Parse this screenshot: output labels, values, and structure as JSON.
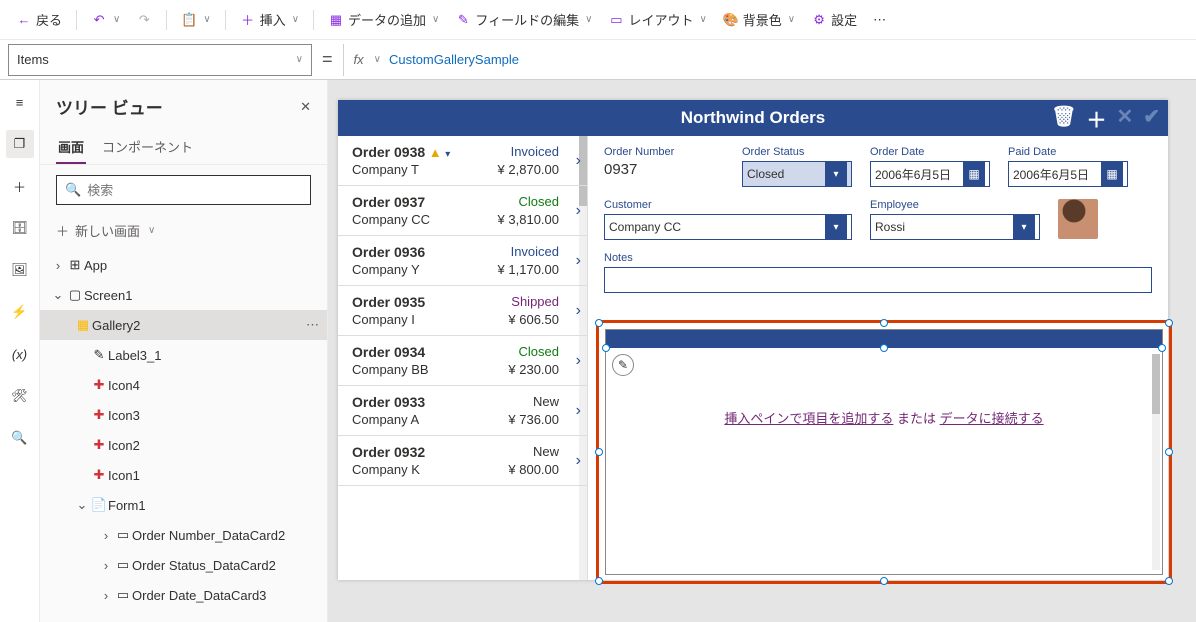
{
  "ribbon": {
    "back": "戻る",
    "insert": "挿入",
    "addData": "データの追加",
    "editFields": "フィールドの編集",
    "layout": "レイアウト",
    "bgColor": "背景色",
    "settings": "設定"
  },
  "formula": {
    "property": "Items",
    "fx": "fx",
    "expression": "CustomGallerySample"
  },
  "tree": {
    "title": "ツリー ビュー",
    "tabScreen": "画面",
    "tabComponents": "コンポーネント",
    "searchPlaceholder": "検索",
    "addScreen": "新しい画面",
    "nodes": {
      "app": "App",
      "screen1": "Screen1",
      "gallery2": "Gallery2",
      "label3_1": "Label3_1",
      "icon4": "Icon4",
      "icon3": "Icon3",
      "icon2": "Icon2",
      "icon1": "Icon1",
      "form1": "Form1",
      "orderNumberCard": "Order Number_DataCard2",
      "orderStatusCard": "Order Status_DataCard2",
      "orderDateCard": "Order Date_DataCard3"
    }
  },
  "app": {
    "title": "Northwind Orders",
    "orders": [
      {
        "num": "Order 0938",
        "warn": true,
        "status": "Invoiced",
        "statusClass": "st-invoiced",
        "company": "Company T",
        "price": "¥ 2,870.00"
      },
      {
        "num": "Order 0937",
        "warn": false,
        "status": "Closed",
        "statusClass": "st-closed",
        "company": "Company CC",
        "price": "¥ 3,810.00"
      },
      {
        "num": "Order 0936",
        "warn": false,
        "status": "Invoiced",
        "statusClass": "st-invoiced",
        "company": "Company Y",
        "price": "¥ 1,170.00"
      },
      {
        "num": "Order 0935",
        "warn": false,
        "status": "Shipped",
        "statusClass": "st-shipped",
        "company": "Company I",
        "price": "¥ 606.50"
      },
      {
        "num": "Order 0934",
        "warn": false,
        "status": "Closed",
        "statusClass": "st-closed",
        "company": "Company BB",
        "price": "¥ 230.00"
      },
      {
        "num": "Order 0933",
        "warn": false,
        "status": "New",
        "statusClass": "st-new",
        "company": "Company A",
        "price": "¥ 736.00"
      },
      {
        "num": "Order 0932",
        "warn": false,
        "status": "New",
        "statusClass": "st-new",
        "company": "Company K",
        "price": "¥ 800.00"
      }
    ],
    "detail": {
      "orderNumberLabel": "Order Number",
      "orderNumber": "0937",
      "orderStatusLabel": "Order Status",
      "orderStatus": "Closed",
      "orderDateLabel": "Order Date",
      "orderDate": "2006年6月5日",
      "paidDateLabel": "Paid Date",
      "paidDate": "2006年6月5日",
      "customerLabel": "Customer",
      "customer": "Company CC",
      "employeeLabel": "Employee",
      "employee": "Rossi",
      "notesLabel": "Notes"
    },
    "galleryHint1": "挿入ペインで項目を追加する",
    "galleryHint2": " または ",
    "galleryHint3": "データに接続する"
  }
}
